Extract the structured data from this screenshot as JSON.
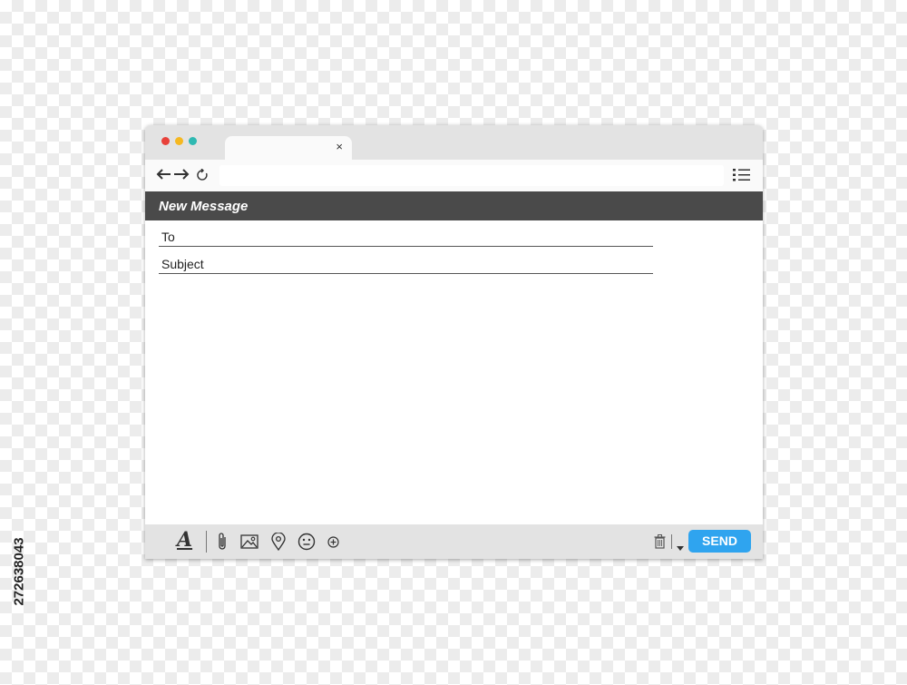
{
  "window": {
    "tab": {
      "close_glyph": "×"
    },
    "traffic_lights": {
      "red": "#e8413a",
      "yellow": "#f5b821",
      "green": "#2fb9b2"
    }
  },
  "toolbar": {
    "back_icon": "arrow-left-icon",
    "forward_icon": "arrow-right-icon",
    "reload_icon": "reload-icon",
    "url_value": "",
    "menu_icon": "list-menu-icon"
  },
  "compose": {
    "title": "New Message",
    "to_label": "To",
    "subject_label": "Subject",
    "body_text": ""
  },
  "bottom_toolbar": {
    "format_label": "A",
    "icons": [
      "font-format-icon",
      "paperclip-icon",
      "image-icon",
      "location-pin-icon",
      "emoji-icon",
      "plus-circle-icon",
      "trash-icon",
      "caret-down-icon"
    ],
    "send_label": "SEND",
    "send_color": "#2fa4ef"
  },
  "stock_id": "272638043"
}
